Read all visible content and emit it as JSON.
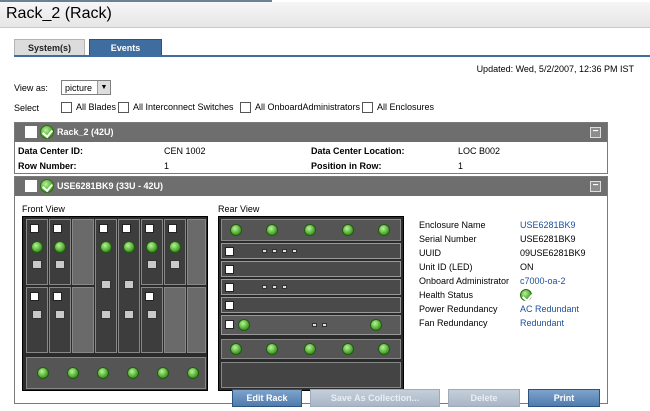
{
  "page": {
    "title": "Rack_2 (Rack)"
  },
  "tabs": [
    {
      "label": "System(s)"
    },
    {
      "label": "Events"
    }
  ],
  "updated": "Updated: Wed, 5/2/2007, 12:36 PM IST",
  "view_as": {
    "label": "View as:",
    "value": "picture"
  },
  "select": {
    "label": "Select",
    "options": [
      "All Blades",
      "All Interconnect Switches",
      "All OnboardAdministrators",
      "All Enclosures"
    ]
  },
  "rack": {
    "header": "Rack_2 (42U)",
    "fields": {
      "dc_id_label": "Data Center ID:",
      "dc_id_value": "CEN 1002",
      "dc_loc_label": "Data Center Location:",
      "dc_loc_value": "LOC B002",
      "row_label": "Row Number:",
      "row_value": "1",
      "pos_label": "Position in Row:",
      "pos_value": "1"
    }
  },
  "enclosure": {
    "header": "USE6281BK9 (33U - 42U)",
    "front_label": "Front View",
    "rear_label": "Rear View",
    "properties": [
      {
        "label": "Enclosure Name",
        "value": "USE6281BK9",
        "link": true
      },
      {
        "label": "Serial Number",
        "value": "USE6281BK9",
        "link": false
      },
      {
        "label": "UUID",
        "value": "09USE6281BK9",
        "link": false
      },
      {
        "label": "Unit ID (LED)",
        "value": "ON",
        "link": false
      },
      {
        "label": "Onboard Administrator",
        "value": "c7000-oa-2",
        "link": true
      },
      {
        "label": "Health Status",
        "value": "",
        "link": false
      },
      {
        "label": "Power Redundancy",
        "value": "AC Redundant",
        "link": true
      },
      {
        "label": "Fan Redundancy",
        "value": "Redundant",
        "link": true
      }
    ]
  },
  "buttons": {
    "edit_rack": "Edit Rack",
    "save_collection": "Save As Collection...",
    "delete": "Delete",
    "print": "Print"
  }
}
